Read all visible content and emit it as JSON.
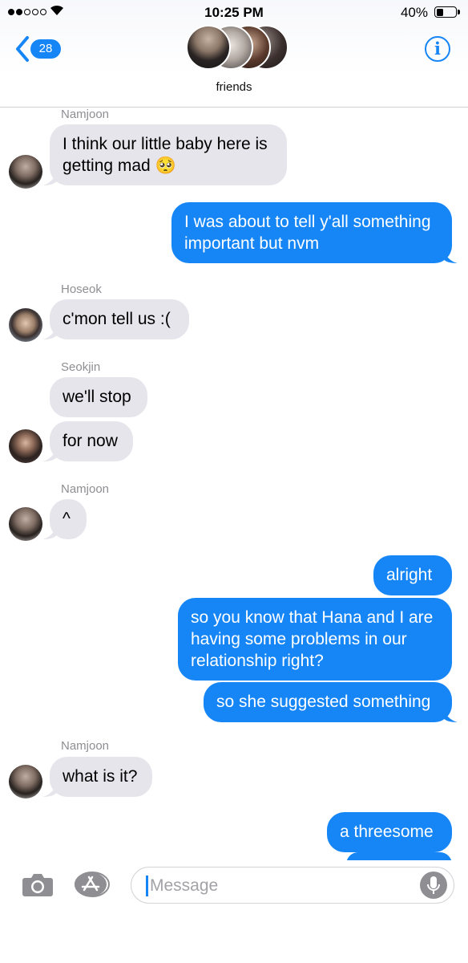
{
  "status_bar": {
    "time": "10:25 PM",
    "battery_percent": "40%",
    "battery_level": 0.4,
    "signal_bars": 2
  },
  "header": {
    "back_count": "28",
    "group_name": "friends",
    "info_glyph": "i"
  },
  "messages": [
    {
      "sender": "Namjoon",
      "direction": "in",
      "text": "I think our little baby here is",
      "text2": "getting mad 🥺"
    },
    {
      "direction": "out",
      "text": "I was about to tell y'all something",
      "text2": "important but nvm"
    },
    {
      "sender": "Hoseok",
      "direction": "in",
      "text": "c'mon tell us :("
    },
    {
      "sender": "Seokjin",
      "direction": "in",
      "text": "we'll stop"
    },
    {
      "direction": "in",
      "text": "for now"
    },
    {
      "sender": "Namjoon",
      "direction": "in",
      "text": "^"
    },
    {
      "direction": "out",
      "text": "alright"
    },
    {
      "direction": "out",
      "text": "so you know that Hana and I are",
      "text2": "having some problems in our",
      "text3": "relationship right?"
    },
    {
      "direction": "out",
      "text": "so she suggested something"
    },
    {
      "sender": "Namjoon",
      "direction": "in",
      "text": "what is it?"
    },
    {
      "direction": "out",
      "text": "a threesome"
    }
  ],
  "composer": {
    "placeholder": "Message"
  },
  "icons": {
    "back": "chevron-left-icon",
    "info": "info-icon",
    "camera": "camera-icon",
    "apps": "app-store-icon",
    "mic": "microphone-icon"
  },
  "colors": {
    "accent": "#1686f6",
    "incoming_bubble": "#e6e5eb",
    "outgoing_bubble": "#1686f6"
  }
}
